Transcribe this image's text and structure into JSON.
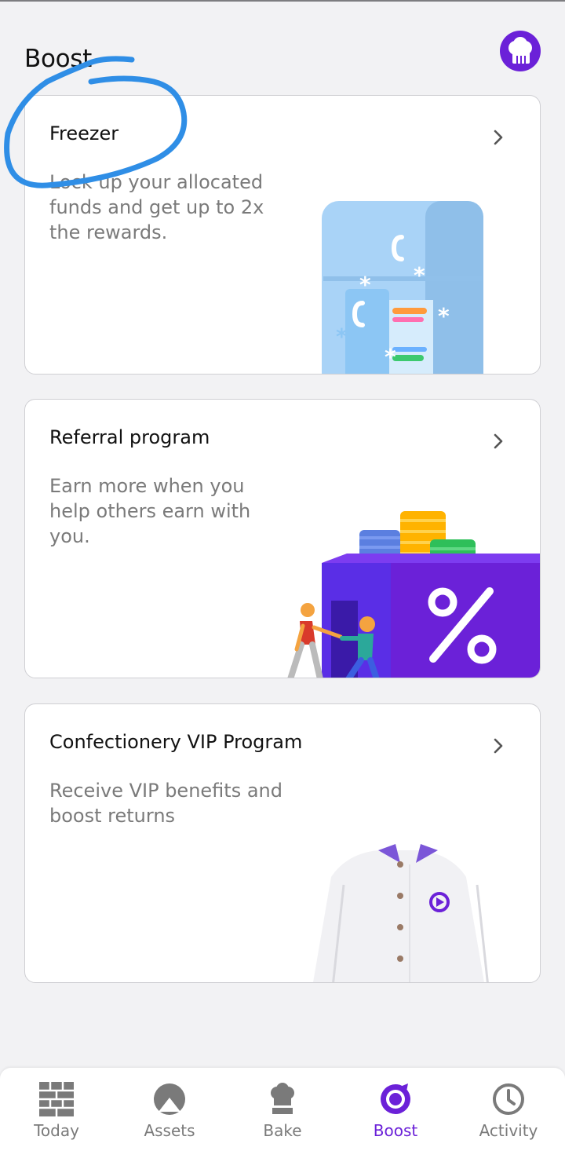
{
  "header": {
    "title": "Boost"
  },
  "cards": [
    {
      "title": "Freezer",
      "description": "Lock up your allocated funds and get up to 2x the rewards."
    },
    {
      "title": "Referral program",
      "description": "Earn more when you help others earn with you."
    },
    {
      "title": "Confectionery VIP Program",
      "description": "Receive VIP benefits and boost returns"
    }
  ],
  "tabbar": {
    "tabs": [
      {
        "label": "Today",
        "icon": "brick-wall-icon"
      },
      {
        "label": "Assets",
        "icon": "pie-icon"
      },
      {
        "label": "Bake",
        "icon": "chef-hat-icon"
      },
      {
        "label": "Boost",
        "icon": "boost-icon"
      },
      {
        "label": "Activity",
        "icon": "clock-icon"
      }
    ],
    "active": "Boost"
  },
  "colors": {
    "accent": "#6b21d8",
    "background": "#f2f2f4",
    "annotation": "#2f8ee6"
  }
}
